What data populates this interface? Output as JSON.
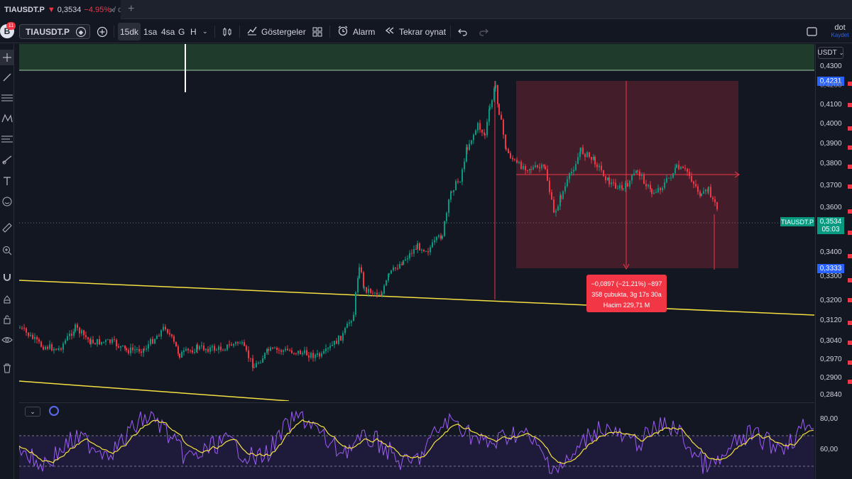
{
  "browser_tab": {
    "symbol": "TIAUSDT.P",
    "change_arrow": "▼",
    "price": "0,3534",
    "change_pct": "−4.95%",
    "tail": "/ do",
    "close_glyph": "×",
    "new_tab_glyph": "+"
  },
  "toolbar": {
    "avatar_letter": "B",
    "avatar_badge": "11",
    "symbol": "TIAUSDT.P",
    "timeframes": [
      "15dk",
      "1sa",
      "4sa",
      "G",
      "H"
    ],
    "indicators_label": "Göstergeler",
    "alarm_label": "Alarm",
    "replay_label": "Tekrar oynat",
    "account_name": "dot",
    "account_save": "Kaydet"
  },
  "icons": {
    "add": "plus-circle-icon",
    "candles": "candlestick-icon",
    "indicators": "indicators-icon",
    "layouts": "grid-icon",
    "alarm": "alarm-clock-icon",
    "replay": "rewind-icon",
    "undo": "undo-icon",
    "redo": "redo-icon",
    "fullscreen": "square-icon"
  },
  "price_axis": {
    "currency": "USDT",
    "ticks": [
      "0,4300",
      "0,4200",
      "0,4100",
      "0,4000",
      "0,3900",
      "0,3800",
      "0,3700",
      "0,3600",
      "0,3400",
      "0,3300",
      "0,3200",
      "0,3120",
      "0,3040",
      "0,2970",
      "0,2900",
      "0,2840"
    ],
    "tag_high": "0,4231",
    "tag_last": "0,3534",
    "tag_countdown": "05:03",
    "tag_low": "0,3333",
    "osc_ticks": [
      "80,00",
      "60,00"
    ]
  },
  "last_price_label": "TIAUSDT.P",
  "measure": {
    "line1": "−0,0897 (−21,21%) −897",
    "line2": "358 çubukta, 3g 17s 30a",
    "line3": "Hacim 229,71 M"
  },
  "colors": {
    "up": "#089981",
    "down": "#f23645",
    "background": "#131722",
    "trendline": "#f5e042",
    "measure_zone": "#f23645",
    "osc_fast": "#9c5cf5",
    "osc_slow": "#f5e042"
  }
}
